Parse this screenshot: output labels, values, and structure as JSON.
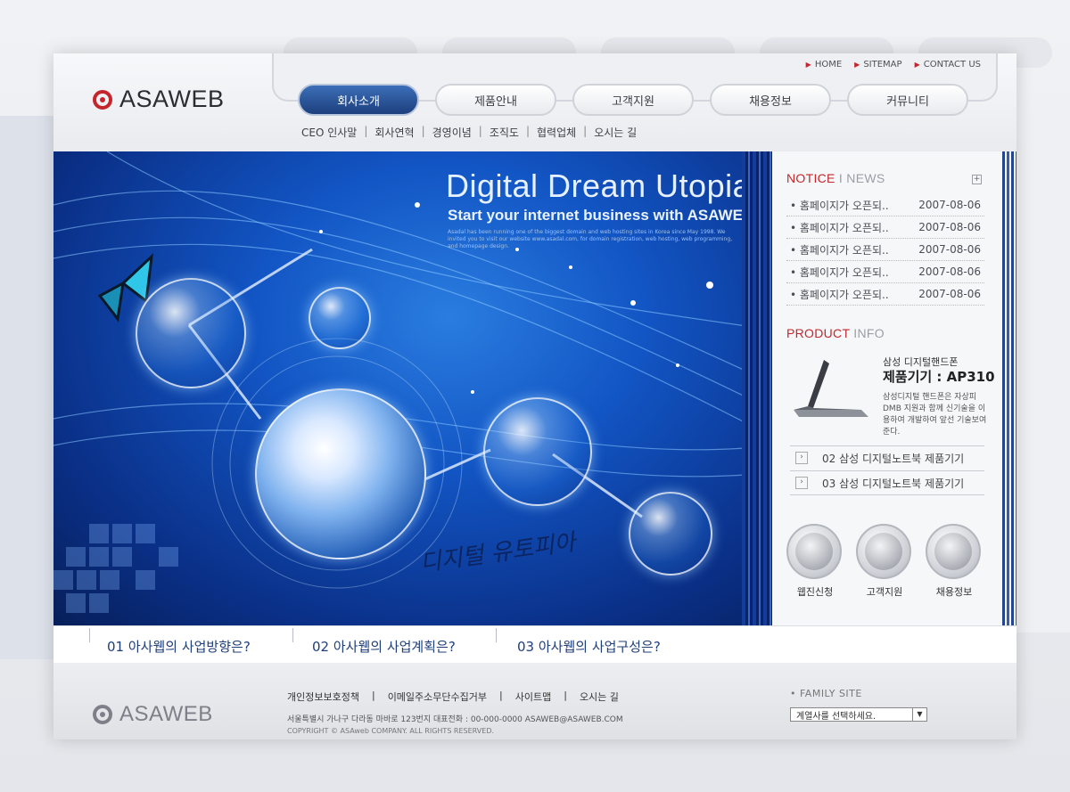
{
  "brand": {
    "logo_text": "ASAWEB"
  },
  "util_links": [
    "HOME",
    "SITEMAP",
    "CONTACT US"
  ],
  "main_nav": [
    "회사소개",
    "제품안내",
    "고객지원",
    "채용정보",
    "커뮤니티"
  ],
  "sub_nav": [
    "CEO 인사말",
    "회사연혁",
    "경영이념",
    "조직도",
    "협력업체",
    "오시는 길"
  ],
  "banner": {
    "title": "Digital Dream Utopia",
    "subtitle": "Start your internet business with ASAWEB",
    "small_text": "Asadal has been running one of the biggest domain and web hosting sites in Korea since May 1998. We invited you to visit our website www.asadal.com, for domain registration, web hosting, web programming, and homepage design.",
    "script": "디지털 유토피아"
  },
  "notice": {
    "title_red": "NOTICE",
    "title_gray": "I NEWS",
    "plus": "+",
    "items": [
      {
        "text": "• 홈페이지가 오픈되..",
        "date": "2007-08-06"
      },
      {
        "text": "• 홈페이지가 오픈되..",
        "date": "2007-08-06"
      },
      {
        "text": "• 홈페이지가 오픈되..",
        "date": "2007-08-06"
      },
      {
        "text": "• 홈페이지가 오픈되..",
        "date": "2007-08-06"
      },
      {
        "text": "• 홈페이지가 오픈되..",
        "date": "2007-08-06"
      }
    ]
  },
  "product": {
    "title_red": "PRODUCT",
    "title_gray": "INFO",
    "name1": "삼성 디지털핸드폰",
    "name2": "제품기기 : AP310",
    "desc": "삼성디지털 핸드폰은 자상피DMB 지원과 함께 신기술을 이용하여 개발하여 앞선 기술보여준다.",
    "links": [
      "02 삼성 디지털노트북 제품기기",
      "03 삼성 디지털노트북 제품기기"
    ],
    "chevron": "›"
  },
  "quick_icons": [
    "웹진신청",
    "고객지원",
    "채용정보"
  ],
  "bottom_links": [
    "01 아사웹의 사업방향은?",
    "02 아사웹의 사업계획은?",
    "03 아사웹의 사업구성은?"
  ],
  "footer": {
    "links": [
      "개인정보보호정책",
      "|",
      "이메일주소무단수집거부",
      "|",
      "사이트맵",
      "|",
      "오시는 길"
    ],
    "address": "서울특별시 가나구 다라동 마바로 123번지   대표전화 : 00-000-0000   ASAWEB@ASAWEB.COM",
    "copyright": "COPYRIGHT © ASAweb COMPANY. ALL RIGHTS RESERVED.",
    "family_label": "• FAMILY SITE",
    "family_select": "계열사를 선택하세요.",
    "dropdown": "▼"
  }
}
